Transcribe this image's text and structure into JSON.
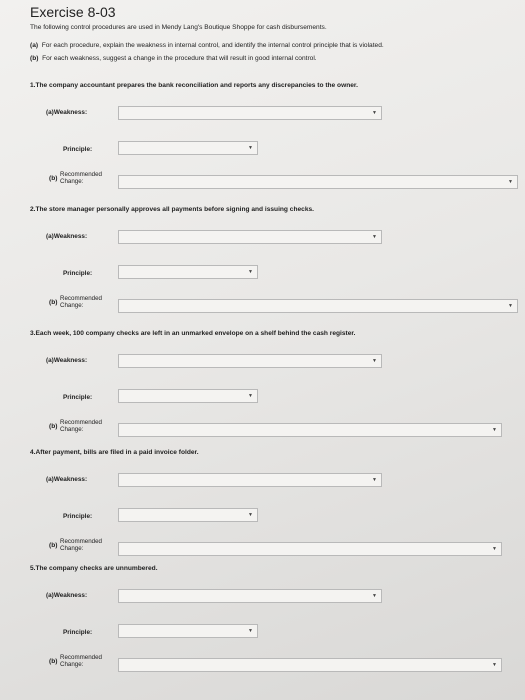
{
  "title": "Exercise 8-03",
  "intro": {
    "line1": "The following control procedures are used in Mendy Lang's Boutique Shoppe for cash disbursements.",
    "line2_tag": "(a)",
    "line2": "For each procedure, explain the weakness in internal control, and identify the internal control principle that is violated.",
    "line3_tag": "(b)",
    "line3": "For each weakness, suggest a change in the procedure that will result in good internal control."
  },
  "labels": {
    "weakness": "Weakness:",
    "a_tag": "(a)",
    "principle": "Principle:",
    "b_tag": "(b)",
    "recommended": "Recommended",
    "change": "Change:"
  },
  "icons": {
    "dropdown": "dropdown-arrow-icon"
  },
  "questions": [
    {
      "number": "1.",
      "text": "The company accountant prepares the bank reconciliation and reports any discrepancies to the owner.",
      "weakness_value": "",
      "principle_value": "",
      "change_value": ""
    },
    {
      "number": "2.",
      "text": "The store manager personally approves all payments before signing and issuing checks.",
      "weakness_value": "",
      "principle_value": "",
      "change_value": ""
    },
    {
      "number": "3.",
      "text": "Each week, 100 company checks are left in an unmarked envelope on a shelf behind the cash register.",
      "weakness_value": "",
      "principle_value": "",
      "change_value": ""
    },
    {
      "number": "4.",
      "text": "After payment, bills are filed in a paid invoice folder.",
      "weakness_value": "",
      "principle_value": "",
      "change_value": ""
    },
    {
      "number": "5.",
      "text": "The company checks are unnumbered.",
      "weakness_value": "",
      "principle_value": "",
      "change_value": ""
    }
  ]
}
